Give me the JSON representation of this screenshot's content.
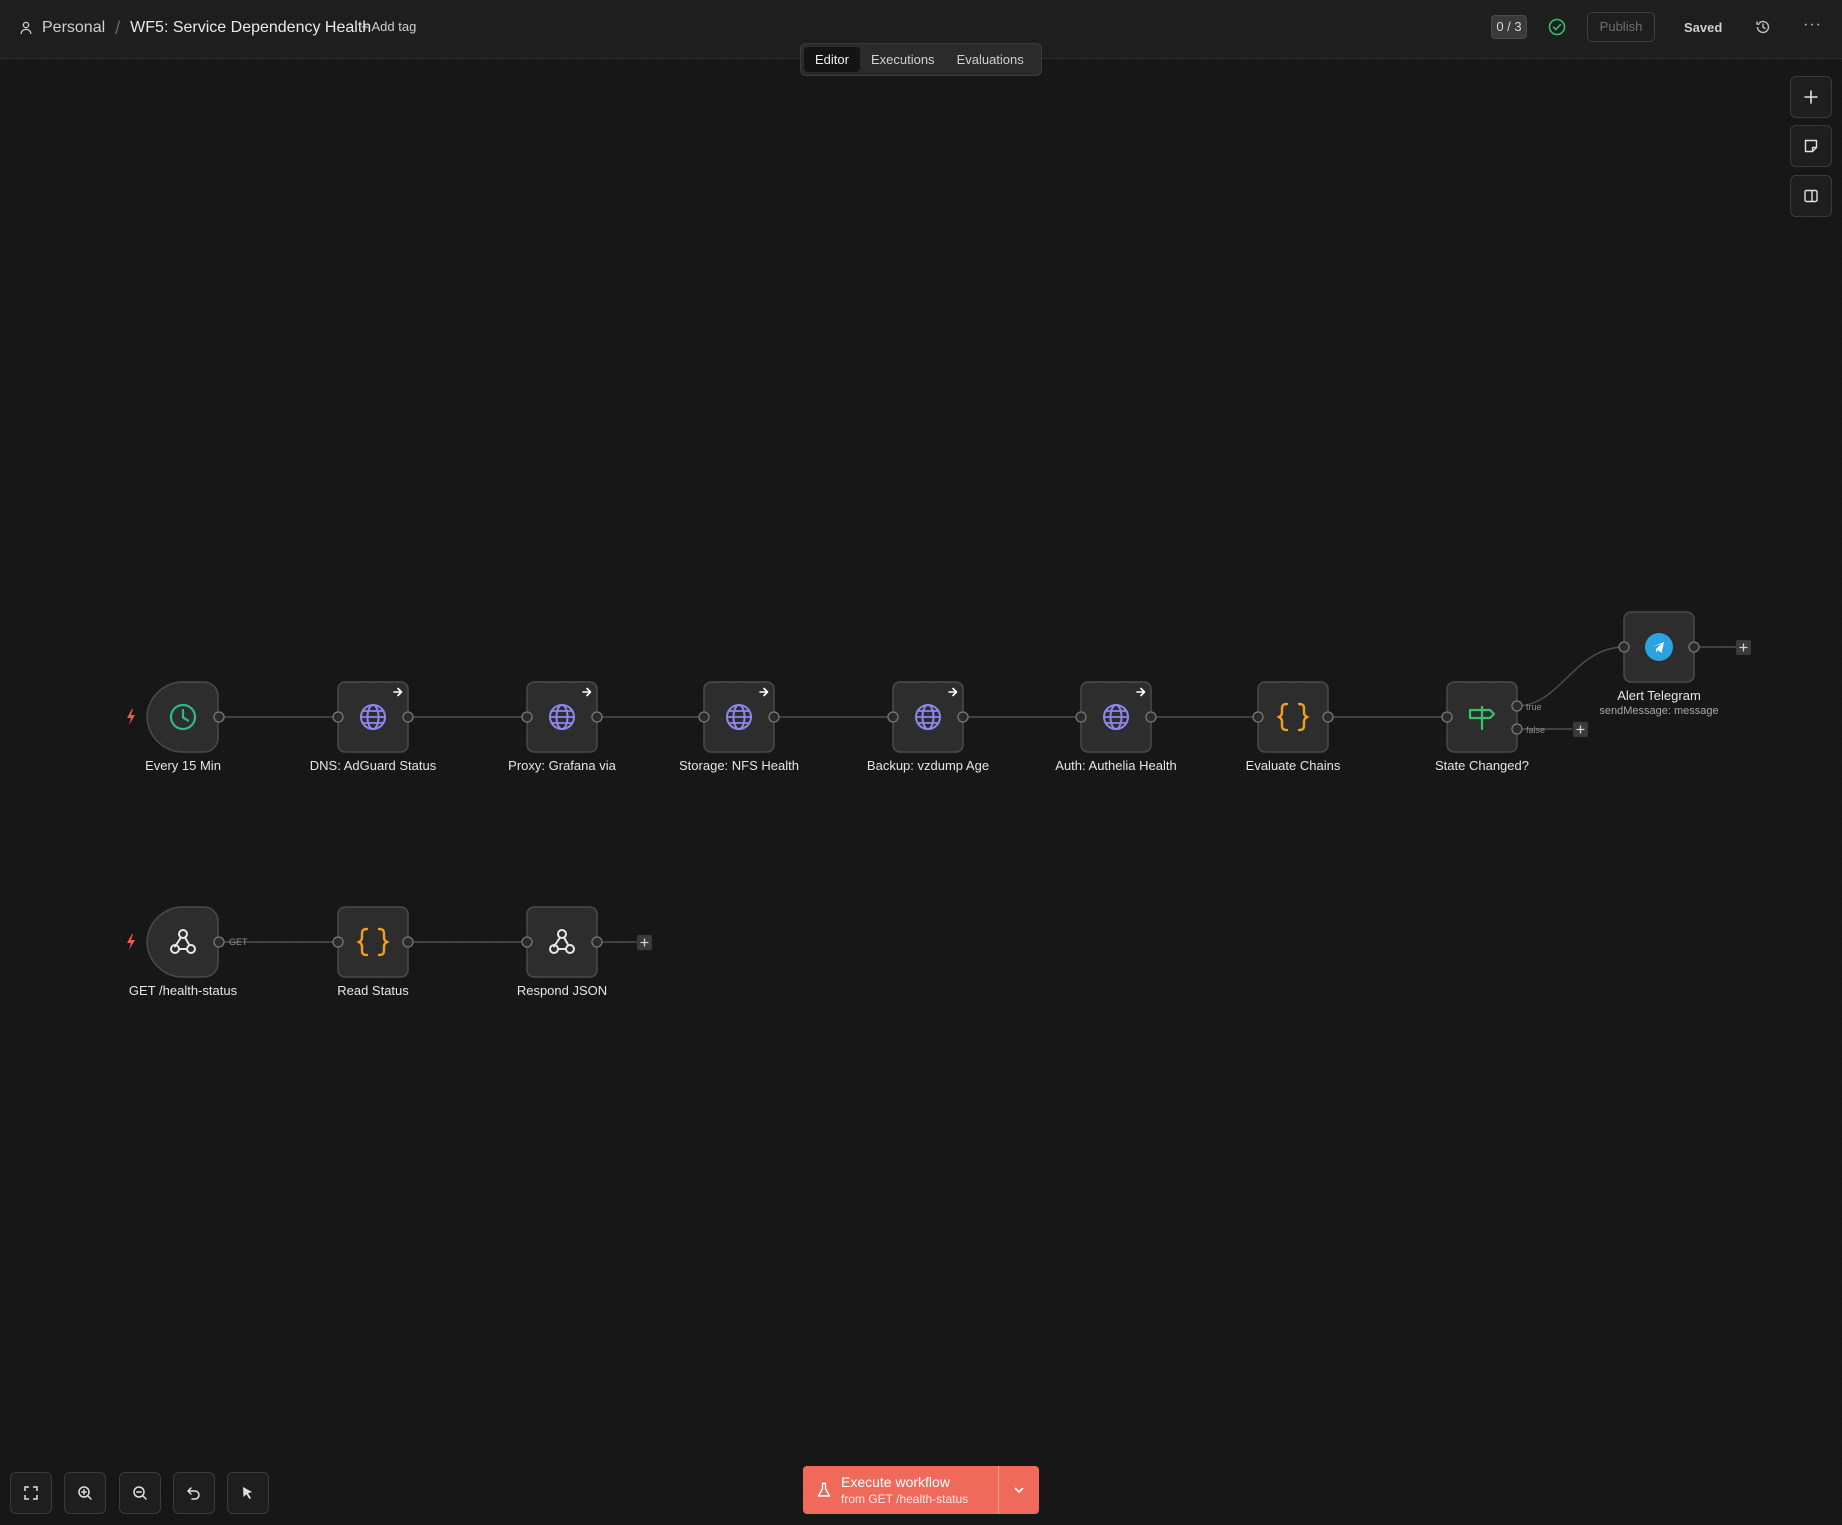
{
  "header": {
    "breadcrumb_project": "Personal",
    "breadcrumb_sep": "/",
    "workflow_title": "WF5: Service Dependency Health",
    "add_tag": "+ Add tag",
    "counter": "0 / 3",
    "publish_label": "Publish",
    "saved_label": "Saved",
    "more_label": "···"
  },
  "tabs": [
    {
      "label": "Editor",
      "active": true
    },
    {
      "label": "Executions",
      "active": false
    },
    {
      "label": "Evaluations",
      "active": false
    }
  ],
  "nodes": {
    "every15": {
      "label": "Every 15 Min",
      "icon": "clock-icon"
    },
    "dns": {
      "label": "DNS: AdGuard Status",
      "icon": "globe-icon"
    },
    "proxy": {
      "label": "Proxy: Grafana via",
      "icon": "globe-icon"
    },
    "storage": {
      "label": "Storage: NFS Health",
      "icon": "globe-icon"
    },
    "backup": {
      "label": "Backup: vzdump Age",
      "icon": "globe-icon"
    },
    "auth": {
      "label": "Auth: Authelia Health",
      "icon": "globe-icon"
    },
    "evaluate": {
      "label": "Evaluate Chains",
      "icon": "code-braces-icon"
    },
    "state": {
      "label": "State Changed?",
      "icon": "signpost-icon"
    },
    "telegram": {
      "label": "Alert Telegram",
      "subtitle": "sendMessage: message",
      "icon": "telegram-icon"
    },
    "webhook": {
      "label": "GET /health-status",
      "icon": "webhook-icon"
    },
    "read": {
      "label": "Read Status",
      "icon": "code-braces-icon"
    },
    "respond": {
      "label": "Respond JSON",
      "icon": "webhook-icon"
    }
  },
  "edge_labels": {
    "true": "true",
    "false": "false",
    "get": "GET"
  },
  "execute": {
    "title": "Execute workflow",
    "subtitle": "from GET /health-status"
  },
  "colors": {
    "accent": "#f06a5c",
    "globe": "#8f86f0",
    "code": "#f0a020",
    "clock": "#2fb98a",
    "if": "#35c26c",
    "telegram": "#2aa3e0",
    "trigger_bolt": "#f05a4a"
  }
}
